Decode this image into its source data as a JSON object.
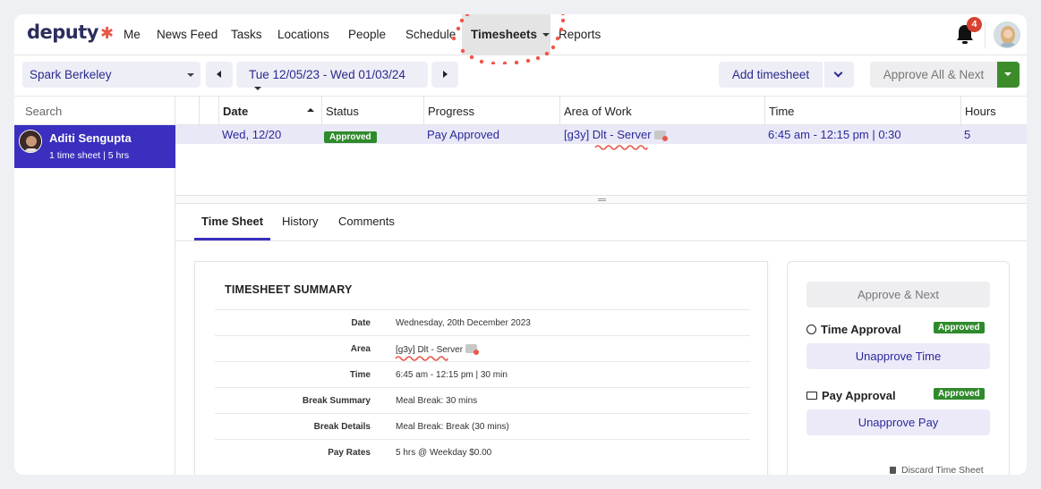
{
  "nav": {
    "logo": "deputy",
    "items": [
      "Me",
      "News Feed",
      "Tasks",
      "Locations",
      "People",
      "Schedule"
    ],
    "active": "Timesheets",
    "reports": "Reports",
    "notification_count": "4"
  },
  "toolbar": {
    "location": "Spark Berkeley",
    "date_range": "Tue 12/05/23 - Wed 01/03/24",
    "add_timesheet": "Add timesheet",
    "approve_all_next": "Approve All & Next"
  },
  "sidebar": {
    "search_placeholder": "Search",
    "employee_name": "Aditi Sengupta",
    "employee_sub": "1 time sheet | 5 hrs"
  },
  "table": {
    "headers": [
      "Date",
      "Status",
      "Progress",
      "Area of Work",
      "Time",
      "Hours"
    ],
    "row": {
      "date": "Wed, 12/20",
      "status": "Approved",
      "progress": "Pay Approved",
      "area": "[g3y] Dlt - Server",
      "time": "6:45 am - 12:15 pm | 0:30",
      "hours": "5"
    }
  },
  "tabs": [
    "Time Sheet",
    "History",
    "Comments"
  ],
  "summary": {
    "title": "TIMESHEET SUMMARY",
    "rows": [
      {
        "label": "Date",
        "value": "Wednesday, 20th December 2023"
      },
      {
        "label": "Area",
        "value": "[g3y] Dlt - Server"
      },
      {
        "label": "Time",
        "value": "6:45 am - 12:15 pm | 30 min"
      },
      {
        "label": "Break Summary",
        "value": "Meal Break: 30 mins"
      },
      {
        "label": "Break Details",
        "value": "Meal Break: Break (30 mins)"
      },
      {
        "label": "Pay Rates",
        "value": "5 hrs @ Weekday $0.00"
      }
    ]
  },
  "approval": {
    "approve_next": "Approve & Next",
    "time_approval": "Time Approval",
    "time_status": "Approved",
    "unapprove_time": "Unapprove Time",
    "pay_approval": "Pay Approval",
    "pay_status": "Approved",
    "unapprove_pay": "Unapprove Pay",
    "discard": "Discard Time Sheet"
  },
  "colors": {
    "brand": "#3a2fbe",
    "approved": "#2f8a2c",
    "accent_red": "#e8584a"
  }
}
